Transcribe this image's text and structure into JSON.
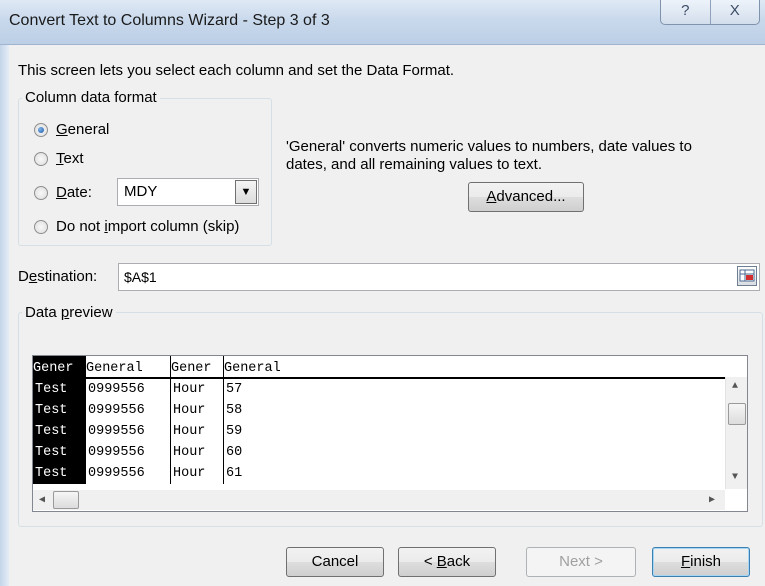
{
  "window": {
    "title": "Convert Text to Columns Wizard - Step 3 of 3",
    "help_glyph": "?",
    "close_glyph": "X"
  },
  "intro_text": "This screen lets you select each column and set the Data Format.",
  "column_format": {
    "legend": "Column data format",
    "options": [
      {
        "pre": "",
        "key": "G",
        "post": "eneral",
        "selected": true
      },
      {
        "pre": "",
        "key": "T",
        "post": "ext",
        "selected": false
      },
      {
        "pre": "",
        "key": "D",
        "post": "ate:",
        "selected": false
      },
      {
        "pre": "Do not ",
        "key": "i",
        "post": "mport column (skip)",
        "selected": false
      }
    ],
    "date_format": "MDY"
  },
  "description_line1": "'General' converts numeric values to numbers, date values to",
  "description_line2": "dates, and all remaining values to text.",
  "advanced_button": {
    "key": "A",
    "rest": "dvanced..."
  },
  "destination": {
    "label_key": "e",
    "label_pre": "D",
    "label_post": "stination:",
    "value": "$A$1"
  },
  "preview": {
    "legend_pre": "Data ",
    "legend_key": "p",
    "legend_post": "review",
    "headers": [
      "Gener",
      "General",
      "Gener",
      "General"
    ],
    "rows": [
      [
        "Test",
        "0999556",
        "Hour",
        "57"
      ],
      [
        "Test",
        "0999556",
        "Hour",
        "58"
      ],
      [
        "Test",
        "0999556",
        "Hour",
        "59"
      ],
      [
        "Test",
        "0999556",
        "Hour",
        "60"
      ],
      [
        "Test",
        "0999556",
        "Hour",
        "61"
      ]
    ],
    "selected_column": 0
  },
  "buttons": {
    "cancel": "Cancel",
    "back_pre": "< ",
    "back_key": "B",
    "back_post": "ack",
    "next": "Next >",
    "finish_key": "F",
    "finish_post": "inish"
  },
  "icons": {
    "up_arrow": "▲",
    "down_arrow": "▼",
    "left_arrow": "◀",
    "right_arrow": "▶",
    "dropdown_arrow": "▼"
  },
  "colors": {
    "accent": "#1b5aa8",
    "selected_column_bg": "#000000"
  }
}
